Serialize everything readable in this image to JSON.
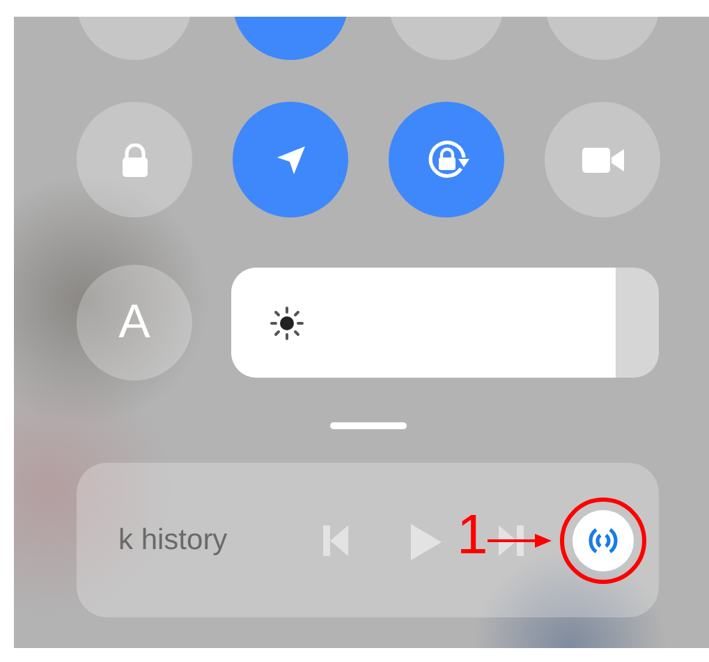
{
  "toggles_top": [
    {
      "on": false
    },
    {
      "on": true
    },
    {
      "on": false
    },
    {
      "on": false
    }
  ],
  "toggles": [
    {
      "on": false
    },
    {
      "on": true
    },
    {
      "on": true
    },
    {
      "on": false
    }
  ],
  "font_button": {
    "label": "A"
  },
  "brightness": {
    "level": 0.9
  },
  "media": {
    "title": "k history",
    "cast_on": true
  },
  "annotation": {
    "label": "1"
  }
}
